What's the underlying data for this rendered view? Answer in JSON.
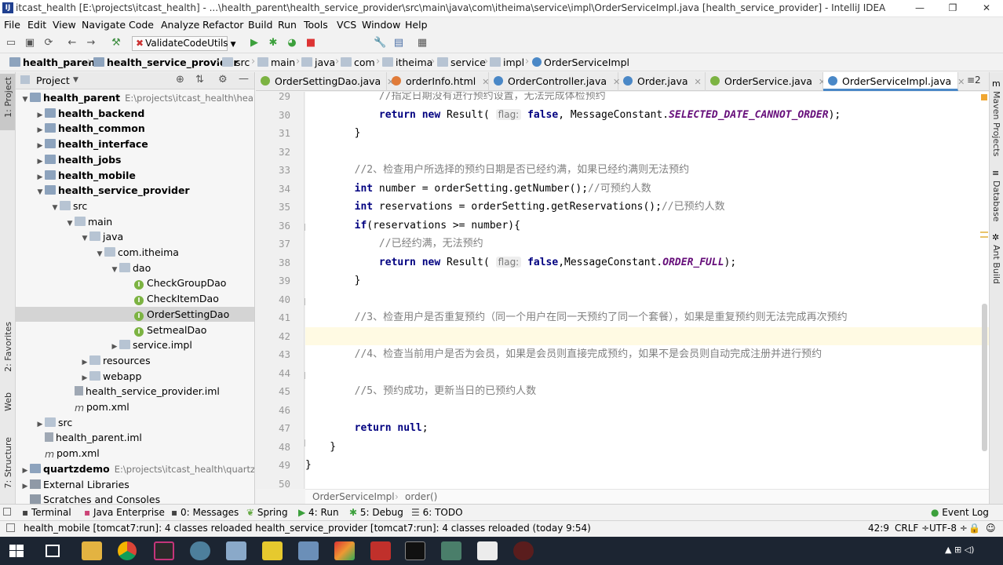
{
  "window": {
    "title": "itcast_health [E:\\projects\\itcast_health] - ...\\health_parent\\health_service_provider\\src\\main\\java\\com\\itheima\\service\\impl\\OrderServiceImpl.java [health_service_provider] - IntelliJ IDEA",
    "app_icon": "IJ",
    "minimize": "—",
    "restore": "❐",
    "close": "✕"
  },
  "menu": [
    "File",
    "Edit",
    "View",
    "Navigate",
    "Code",
    "Analyze",
    "Refactor",
    "Build",
    "Run",
    "Tools",
    "VCS",
    "Window",
    "Help"
  ],
  "toolbar": {
    "run_config": "ValidateCodeUtils",
    "icons": [
      "open-icon",
      "save-icon",
      "sync-icon",
      "back-icon",
      "forward-icon",
      "hammer-icon",
      "run-icon",
      "debug-icon",
      "coverage-icon",
      "stop-icon",
      "wrench-icon",
      "structure-icon",
      "sdk-icon"
    ]
  },
  "breadcrumb": [
    "health_parent",
    "health_service_provider",
    "src",
    "main",
    "java",
    "com",
    "itheima",
    "service",
    "impl",
    "OrderServiceImpl"
  ],
  "left_stripe": [
    "1: Project",
    "2: Favorites",
    "Web",
    "7: Structure"
  ],
  "project": {
    "header": "Project",
    "tree": [
      {
        "label": "health_parent",
        "extra": "E:\\projects\\itcast_health\\health_pa",
        "indent": 0,
        "arrow": "▼",
        "icon": "folderm",
        "bold": true
      },
      {
        "label": "health_backend",
        "indent": 1,
        "arrow": "▶",
        "icon": "folderm",
        "bold": true
      },
      {
        "label": "health_common",
        "indent": 1,
        "arrow": "▶",
        "icon": "folderm",
        "bold": true
      },
      {
        "label": "health_interface",
        "indent": 1,
        "arrow": "▶",
        "icon": "folderm",
        "bold": true
      },
      {
        "label": "health_jobs",
        "indent": 1,
        "arrow": "▶",
        "icon": "folderm",
        "bold": true
      },
      {
        "label": "health_mobile",
        "indent": 1,
        "arrow": "▶",
        "icon": "folderm",
        "bold": true
      },
      {
        "label": "health_service_provider",
        "indent": 1,
        "arrow": "▼",
        "icon": "folderm",
        "bold": true
      },
      {
        "label": "src",
        "indent": 2,
        "arrow": "▼",
        "icon": "folder"
      },
      {
        "label": "main",
        "indent": 3,
        "arrow": "▼",
        "icon": "folder"
      },
      {
        "label": "java",
        "indent": 4,
        "arrow": "▼",
        "icon": "folder"
      },
      {
        "label": "com.itheima",
        "indent": 5,
        "arrow": "▼",
        "icon": "folder"
      },
      {
        "label": "dao",
        "indent": 6,
        "arrow": "▼",
        "icon": "folder"
      },
      {
        "label": "CheckGroupDao",
        "indent": 7,
        "arrow": "",
        "icon": "interface"
      },
      {
        "label": "CheckItemDao",
        "indent": 7,
        "arrow": "",
        "icon": "interface"
      },
      {
        "label": "OrderSettingDao",
        "indent": 7,
        "arrow": "",
        "icon": "interface",
        "selected": true
      },
      {
        "label": "SetmealDao",
        "indent": 7,
        "arrow": "",
        "icon": "interface"
      },
      {
        "label": "service.impl",
        "indent": 6,
        "arrow": "▶",
        "icon": "folder"
      },
      {
        "label": "resources",
        "indent": 4,
        "arrow": "▶",
        "icon": "folder"
      },
      {
        "label": "webapp",
        "indent": 4,
        "arrow": "▶",
        "icon": "folder"
      },
      {
        "label": "health_service_provider.iml",
        "indent": 3,
        "arrow": "",
        "icon": "file"
      },
      {
        "label": "pom.xml",
        "indent": 3,
        "arrow": "",
        "icon": "maven"
      },
      {
        "label": "src",
        "indent": 1,
        "arrow": "▶",
        "icon": "folder"
      },
      {
        "label": "health_parent.iml",
        "indent": 1,
        "arrow": "",
        "icon": "file"
      },
      {
        "label": "pom.xml",
        "indent": 1,
        "arrow": "",
        "icon": "maven"
      },
      {
        "label": "quartzdemo",
        "extra": "E:\\projects\\itcast_health\\quartzdem",
        "indent": 0,
        "arrow": "▶",
        "icon": "folderm",
        "bold": true
      },
      {
        "label": "External Libraries",
        "indent": 0,
        "arrow": "▶",
        "icon": "lib"
      },
      {
        "label": "Scratches and Consoles",
        "indent": 0,
        "arrow": "",
        "icon": "lib"
      }
    ]
  },
  "tabs": [
    {
      "label": "OrderSettingDao.java",
      "color": "#7cb342"
    },
    {
      "label": "orderInfo.html",
      "color": "#e07b39"
    },
    {
      "label": "OrderController.java",
      "color": "#4a88c7"
    },
    {
      "label": "Order.java",
      "color": "#4a88c7"
    },
    {
      "label": "OrderService.java",
      "color": "#7cb342"
    },
    {
      "label": "OrderServiceImpl.java",
      "color": "#4a88c7",
      "active": true
    }
  ],
  "tab_overflow": "≡2",
  "editor": {
    "lines": [
      {
        "n": "29",
        "html": "            <span class=\"cm\">//指定日期没有进行预约设置，无法完成体检预约</span>"
      },
      {
        "n": "30",
        "html": "            <span class=\"kw\">return new</span> Result( <span class=\"hint\">flag:</span> <span class=\"kw\">false</span>, MessageConstant.<span class=\"cst\">SELECTED_DATE_CANNOT_ORDER</span>);"
      },
      {
        "n": "31",
        "html": "        }"
      },
      {
        "n": "32",
        "html": ""
      },
      {
        "n": "33",
        "html": "        <span class=\"cm\">//2、检查用户所选择的预约日期是否已经约满，如果已经约满则无法预约</span>"
      },
      {
        "n": "34",
        "html": "        <span class=\"kw\">int</span> number = orderSetting.getNumber();<span class=\"cm\">//可预约人数</span>"
      },
      {
        "n": "35",
        "html": "        <span class=\"kw\">int</span> reservations = orderSetting.getReservations();<span class=\"cm\">//已预约人数</span>"
      },
      {
        "n": "36",
        "html": "        <span class=\"kw\">if</span>(reservations &gt;= number){"
      },
      {
        "n": "37",
        "html": "            <span class=\"cm\">//已经约满，无法预约</span>"
      },
      {
        "n": "38",
        "html": "            <span class=\"kw\">return new</span> Result( <span class=\"hint\">flag:</span> <span class=\"kw\">false</span>,MessageConstant.<span class=\"cst\">ORDER_FULL</span>);"
      },
      {
        "n": "39",
        "html": "        }"
      },
      {
        "n": "40",
        "html": ""
      },
      {
        "n": "41",
        "html": "        <span class=\"cm\">//3、检查用户是否重复预约（同一个用户在同一天预约了同一个套餐），如果是重复预约则无法完成再次预约</span>"
      },
      {
        "n": "42",
        "html": "",
        "current": true
      },
      {
        "n": "43",
        "html": "        <span class=\"cm\">//4、检查当前用户是否为会员，如果是会员则直接完成预约，如果不是会员则自动完成注册并进行预约</span>"
      },
      {
        "n": "44",
        "html": ""
      },
      {
        "n": "45",
        "html": "        <span class=\"cm\">//5、预约成功，更新当日的已预约人数</span>"
      },
      {
        "n": "46",
        "html": ""
      },
      {
        "n": "47",
        "html": "        <span class=\"kw\">return null</span>;"
      },
      {
        "n": "48",
        "html": "    }"
      },
      {
        "n": "49",
        "html": "}"
      },
      {
        "n": "50",
        "html": ""
      }
    ],
    "crumb": [
      "OrderServiceImpl",
      "order()"
    ]
  },
  "right_stripe": [
    "Maven Projects",
    "Database",
    "Ant Build"
  ],
  "toolwindows": [
    {
      "label": "Terminal"
    },
    {
      "label": "Java Enterprise"
    },
    {
      "label": "0: Messages"
    },
    {
      "label": "Spring"
    },
    {
      "label": "4: Run"
    },
    {
      "label": "5: Debug"
    },
    {
      "label": "6: TODO"
    }
  ],
  "event_log": "Event Log",
  "status": {
    "message": "health_mobile [tomcat7:run]: 4 classes reloaded health_service_provider [tomcat7:run]: 4 classes reloaded (today 9:54)",
    "position": "42:9",
    "line_sep": "CRLF ÷",
    "encoding": "UTF-8 ÷"
  },
  "taskbar": {
    "start_icon": "windows-icon",
    "time_hint": "▲ ⊞ ◁)"
  }
}
